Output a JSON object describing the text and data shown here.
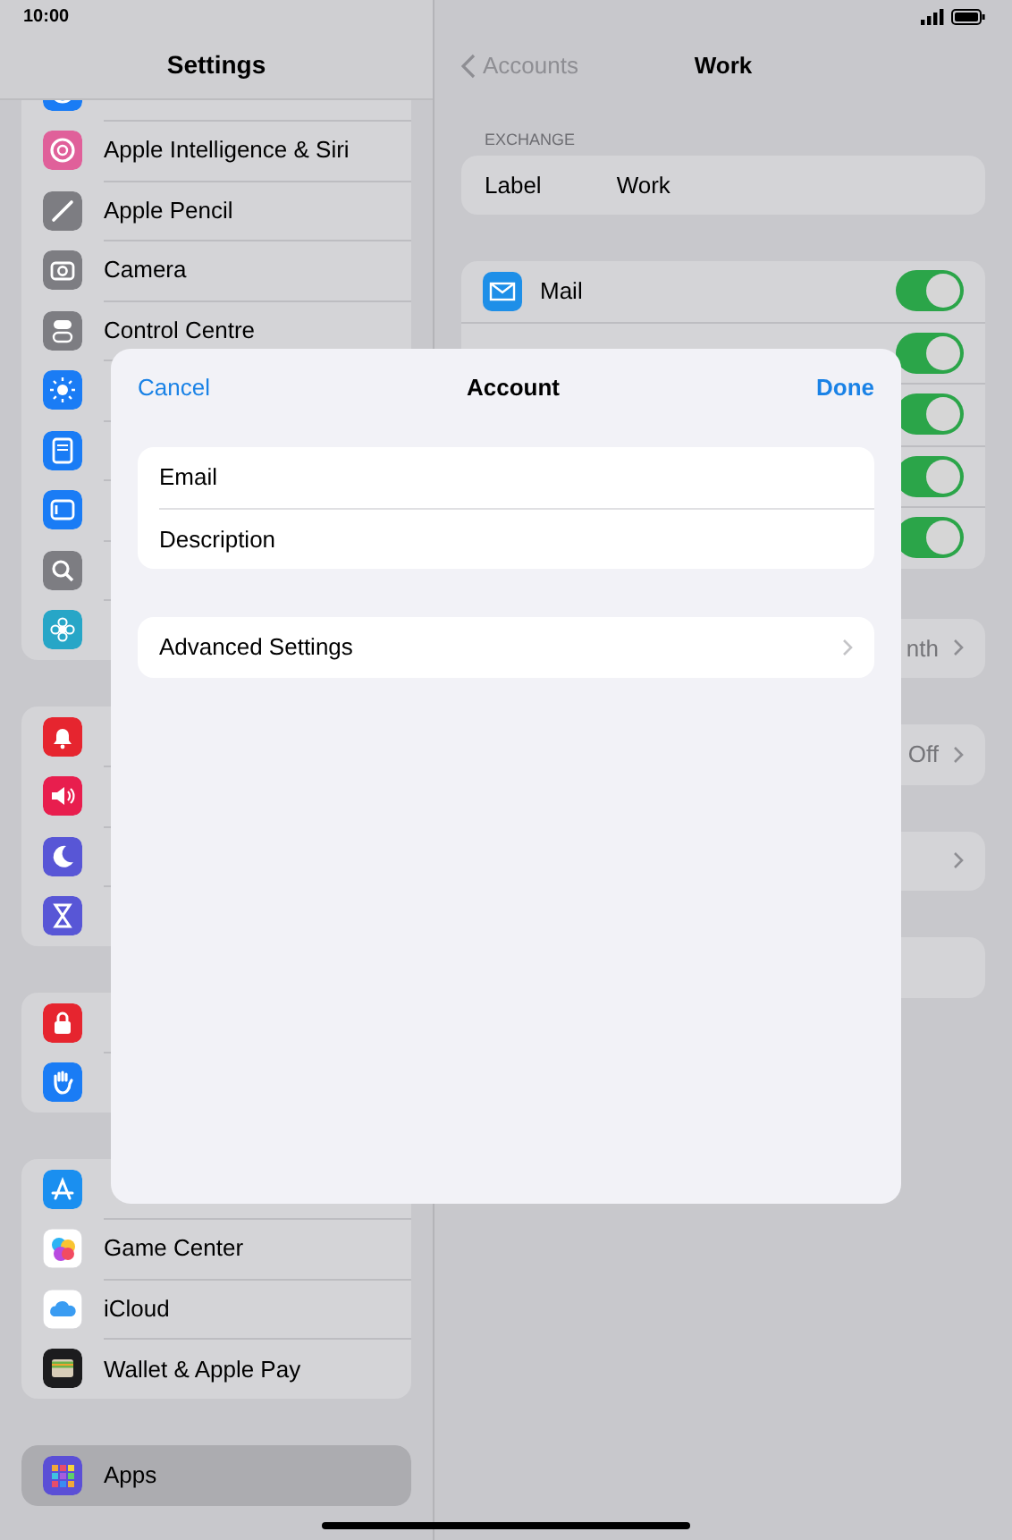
{
  "status_bar": {
    "time": "10:00"
  },
  "sidebar": {
    "title": "Settings",
    "groups": [
      {
        "items": [
          {
            "color": "#1a7cf5",
            "selected": false
          },
          {
            "label": "Apple Intelligence & Siri",
            "color": "#e0609a",
            "selected": false
          },
          {
            "label": "Apple Pencil",
            "color": "#7d7d82",
            "selected": false
          },
          {
            "label": "Camera",
            "color": "#7d7d82",
            "selected": false
          },
          {
            "label": "Control Centre",
            "color": "#7d7d82",
            "selected": false
          },
          {
            "color": "#1a7cf5",
            "selected": false
          },
          {
            "color": "#1a7cf5",
            "selected": false
          },
          {
            "color": "#1a7cf5",
            "selected": false
          },
          {
            "color": "#7d7d82",
            "selected": false
          },
          {
            "color": "#27a6c7",
            "selected": false
          }
        ]
      },
      {
        "items": [
          {
            "color": "#e6252f",
            "selected": false
          },
          {
            "color": "#e81e4e",
            "selected": false
          },
          {
            "color": "#5856d6",
            "selected": false
          },
          {
            "color": "#5856d6",
            "selected": false
          }
        ]
      },
      {
        "items": [
          {
            "color": "#e6252f",
            "selected": false
          },
          {
            "color": "#1a7cf5",
            "selected": false
          }
        ]
      },
      {
        "items": [
          {
            "color": "#1a8ff0",
            "selected": false
          },
          {
            "label": "Game Center",
            "color": "#ffffff",
            "selected": false
          },
          {
            "label": "iCloud",
            "color": "#ffffff",
            "selected": false
          },
          {
            "label": "Wallet & Apple Pay",
            "color": "#1c1c1e",
            "selected": false
          }
        ]
      },
      {
        "items": [
          {
            "label": "Apps",
            "color": "#5b4fd6",
            "selected": true
          }
        ]
      }
    ]
  },
  "detail": {
    "back": "Accounts",
    "title": "Work",
    "section": "EXCHANGE",
    "label_row": {
      "label": "Label",
      "value": "Work"
    },
    "toggles": [
      {
        "label": "Mail",
        "on": true
      },
      {
        "on": true
      },
      {
        "on": true
      },
      {
        "on": true
      },
      {
        "on": true
      }
    ],
    "rows": [
      {
        "value": "nth"
      },
      {
        "value": "Off"
      },
      {
        "chevron": true
      }
    ]
  },
  "modal": {
    "cancel": "Cancel",
    "title": "Account",
    "done": "Done",
    "fields": [
      {
        "label": "Email"
      },
      {
        "label": "Description"
      }
    ],
    "advanced": "Advanced Settings"
  }
}
